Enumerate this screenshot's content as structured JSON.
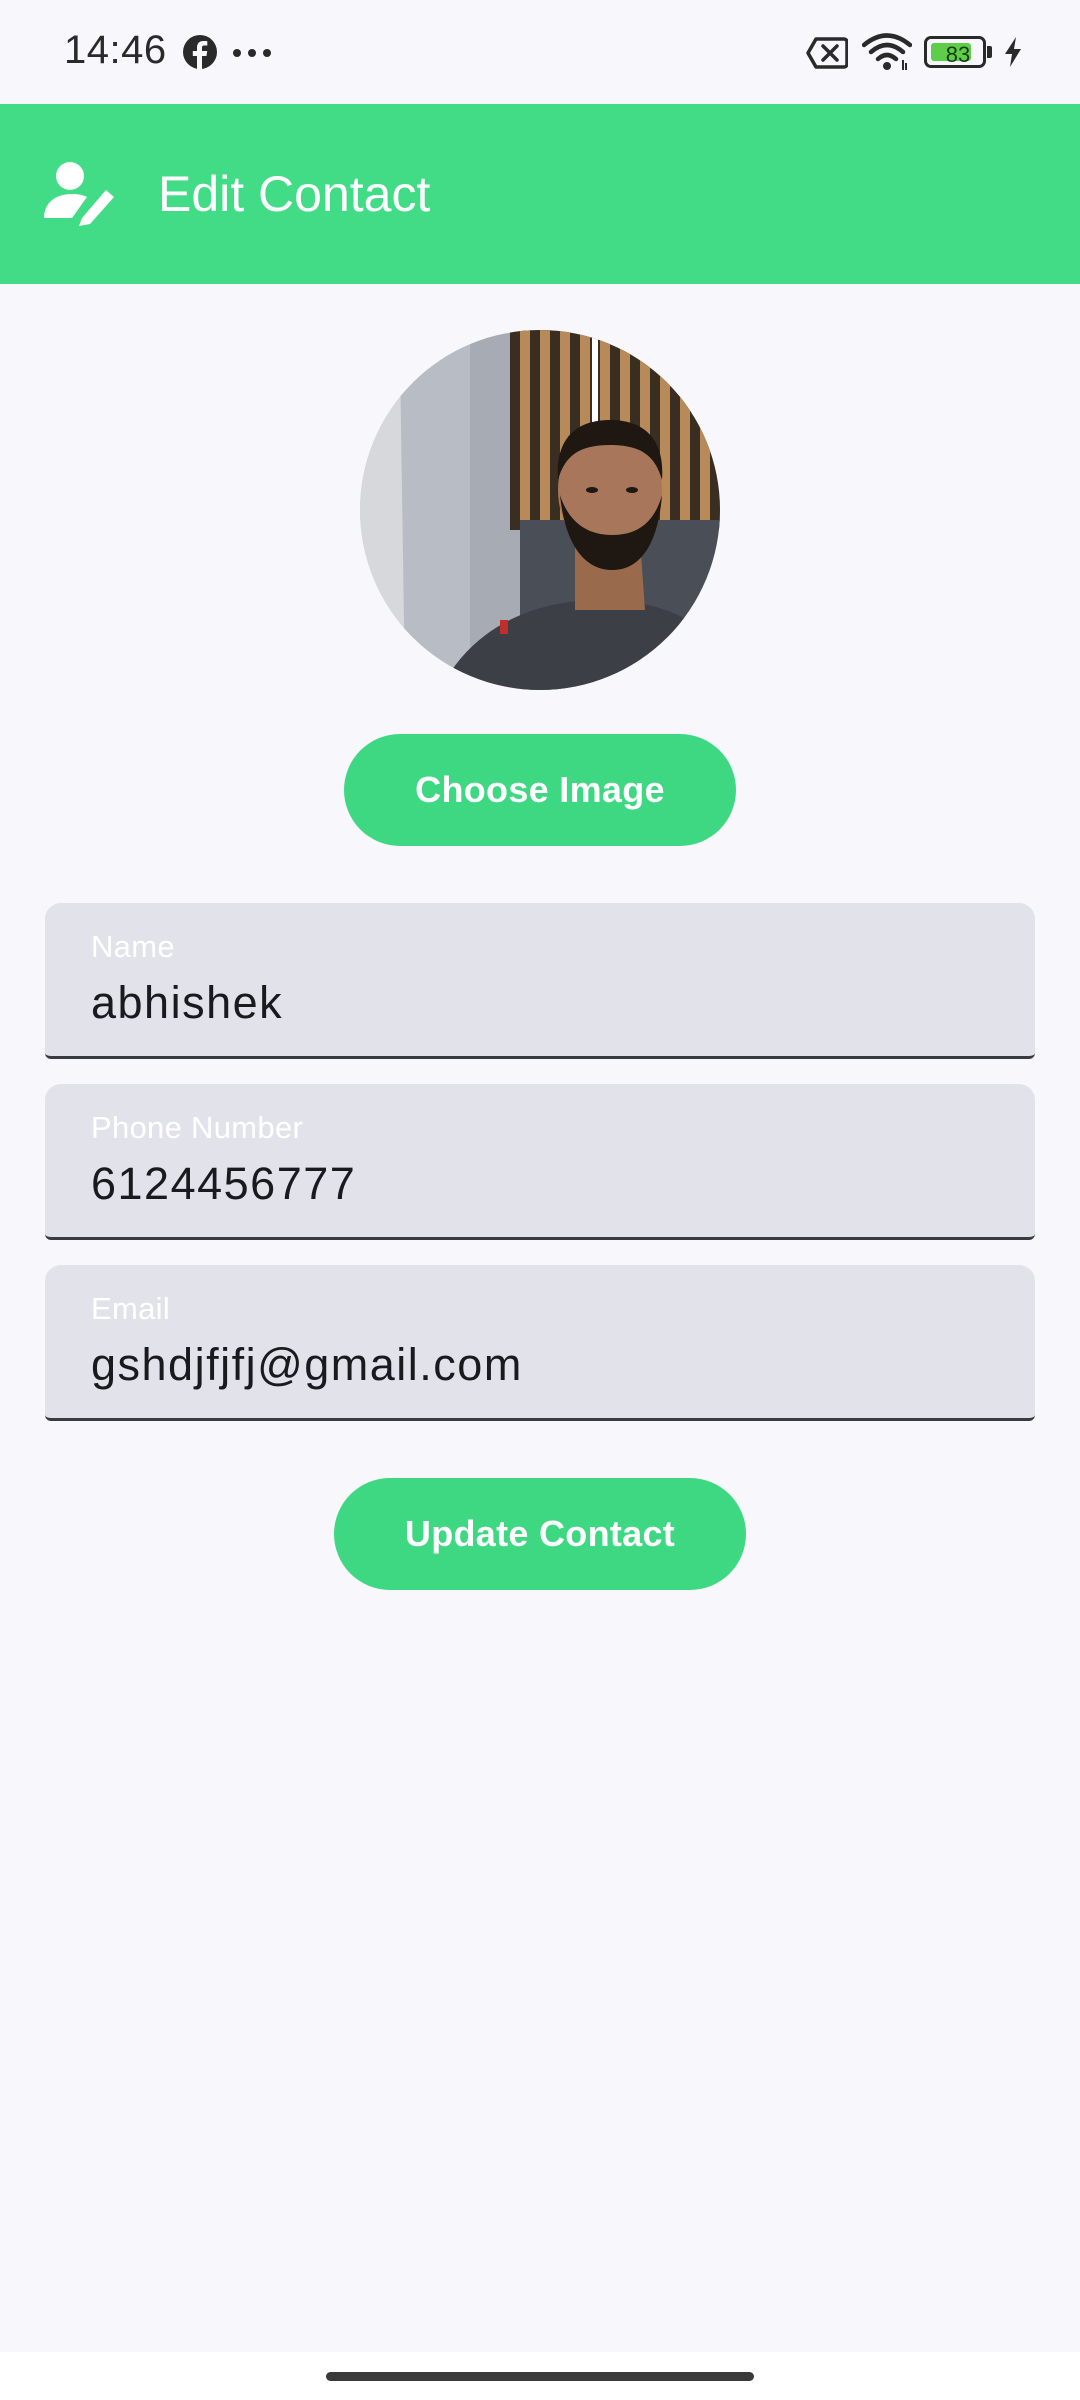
{
  "status_bar": {
    "time": "14:46",
    "battery_level": "83",
    "battery_fraction": 0.83,
    "icons": [
      "facebook-icon",
      "more-dots-icon",
      "no-sim-icon",
      "wifi-icon",
      "battery-icon",
      "charging-icon"
    ]
  },
  "app_bar": {
    "title": "Edit Contact",
    "icon": "edit-person-icon",
    "color": "#42dc87"
  },
  "avatar": {
    "kind": "contact-photo"
  },
  "buttons": {
    "choose_image": "Choose Image",
    "update_contact": "Update Contact"
  },
  "form": {
    "name": {
      "label": "Name",
      "value": "abhishek"
    },
    "phone": {
      "label": "Phone Number",
      "value": "6124456777"
    },
    "email": {
      "label": "Email",
      "value": "gshdjfjfj@gmail.com"
    }
  },
  "colors": {
    "accent": "#42dc87",
    "background": "#f7f7fc",
    "field_background": "#e2e2ea"
  }
}
